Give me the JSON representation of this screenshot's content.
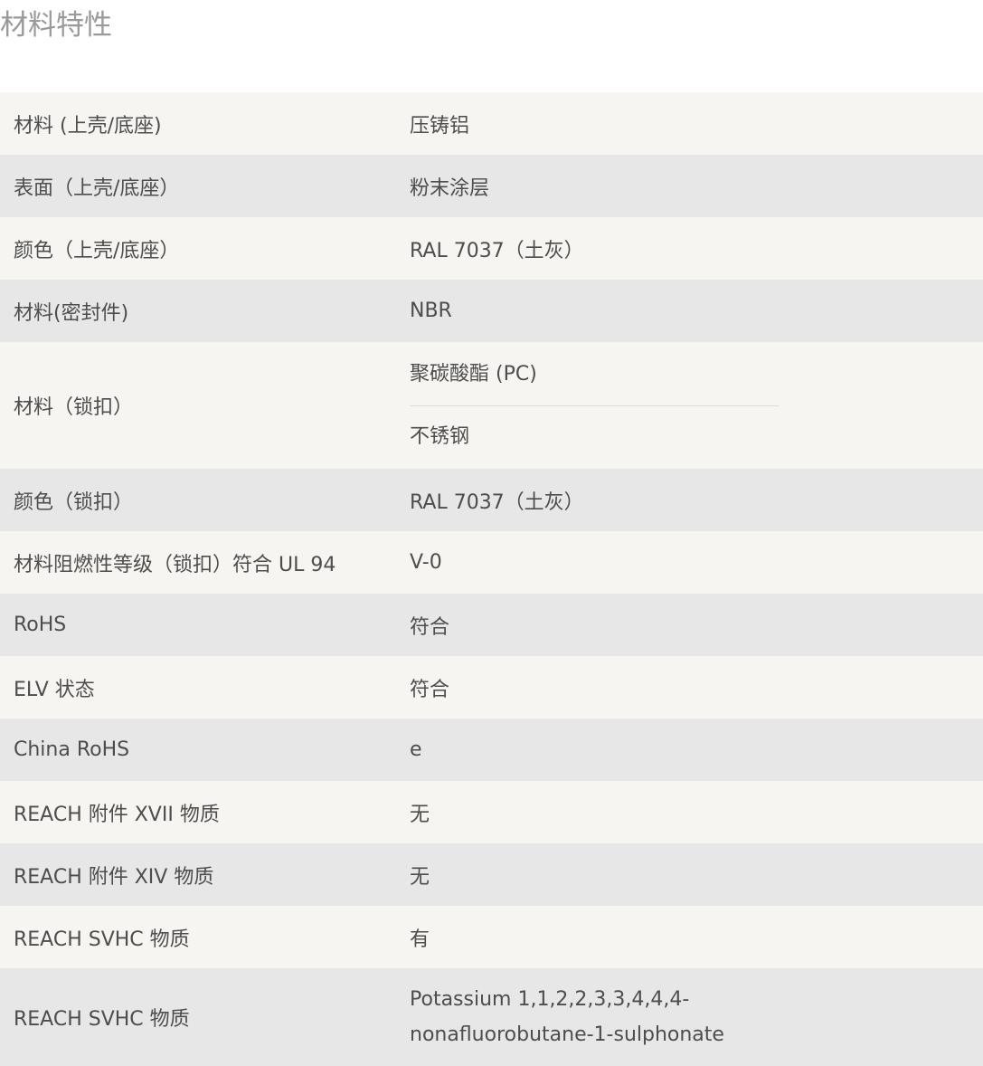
{
  "page": {
    "title": "材料特性"
  },
  "rows": [
    {
      "label": "材料 (上壳/底座)",
      "values": [
        "压铸铝"
      ]
    },
    {
      "label": "表面（上壳/底座）",
      "values": [
        "粉末涂层"
      ]
    },
    {
      "label": "颜色（上壳/底座）",
      "values": [
        "RAL 7037（土灰）"
      ]
    },
    {
      "label": "材料(密封件)",
      "values": [
        "NBR"
      ]
    },
    {
      "label": "材料（锁扣）",
      "values": [
        "聚碳酸酯 (PC)",
        "不锈钢"
      ]
    },
    {
      "label": "颜色（锁扣）",
      "values": [
        "RAL 7037（土灰）"
      ]
    },
    {
      "label": "材料阻燃性等级（锁扣）符合 UL 94",
      "values": [
        "V-0"
      ]
    },
    {
      "label": "RoHS",
      "values": [
        "符合"
      ]
    },
    {
      "label": "ELV 状态",
      "values": [
        "符合"
      ]
    },
    {
      "label": "China RoHS",
      "values": [
        "e"
      ]
    },
    {
      "label": "REACH 附件 XVII 物质",
      "values": [
        "无"
      ]
    },
    {
      "label": "REACH 附件 XIV 物质",
      "values": [
        "无"
      ]
    },
    {
      "label": "REACH SVHC 物质",
      "values": [
        "有"
      ]
    },
    {
      "label": "REACH SVHC 物质",
      "values": [
        "Potassium 1,1,2,2,3,3,4,4,4-nonafluorobutane-1-sulphonate"
      ]
    }
  ]
}
